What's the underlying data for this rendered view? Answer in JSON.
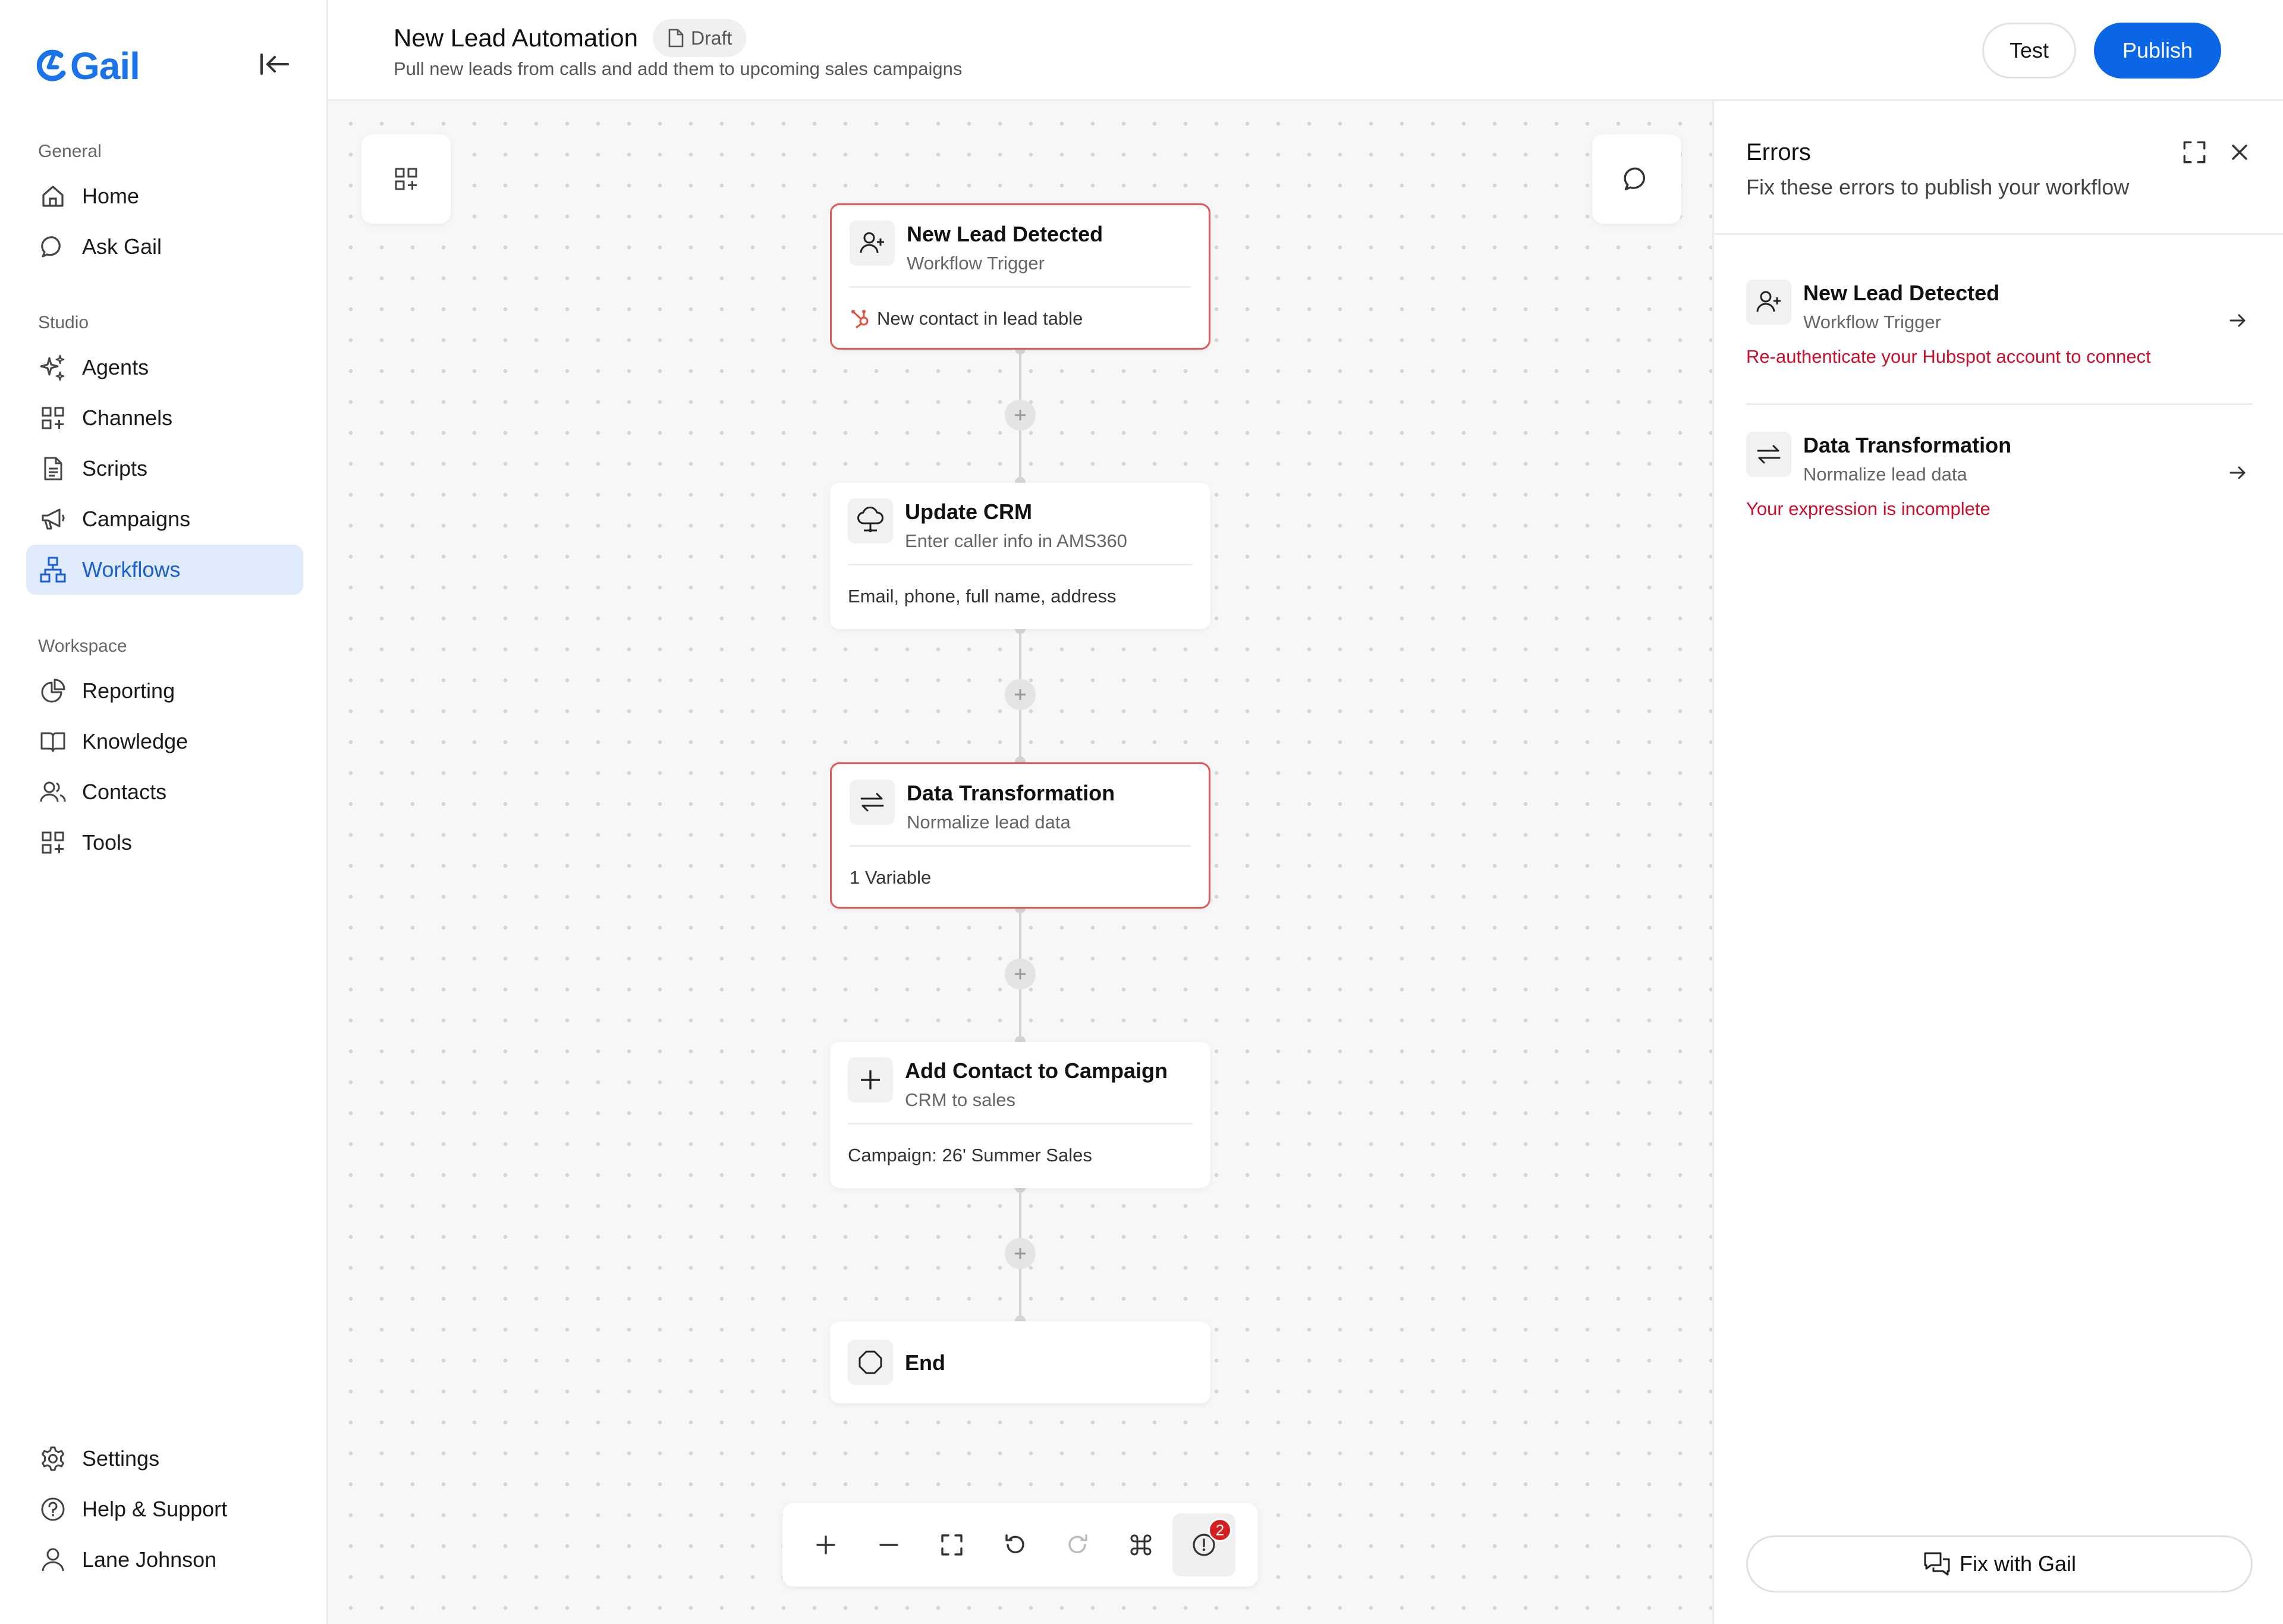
{
  "app": {
    "brand": "Gail",
    "brand_color": "#1a73e8",
    "accent_color": "#0a66e4",
    "error_color": "#c8102e"
  },
  "sidebar": {
    "sections": [
      {
        "label": "General",
        "items": [
          {
            "label": "Home",
            "icon": "home-icon"
          },
          {
            "label": "Ask Gail",
            "icon": "chat-bubble-icon"
          }
        ]
      },
      {
        "label": "Studio",
        "items": [
          {
            "label": "Agents",
            "icon": "sparkle-icon"
          },
          {
            "label": "Channels",
            "icon": "grid-plus-icon"
          },
          {
            "label": "Scripts",
            "icon": "document-icon"
          },
          {
            "label": "Campaigns",
            "icon": "megaphone-icon"
          },
          {
            "label": "Workflows",
            "icon": "workflow-icon",
            "active": true
          }
        ]
      },
      {
        "label": "Workspace",
        "items": [
          {
            "label": "Reporting",
            "icon": "pie-chart-icon"
          },
          {
            "label": "Knowledge",
            "icon": "book-icon"
          },
          {
            "label": "Contacts",
            "icon": "users-icon"
          },
          {
            "label": "Tools",
            "icon": "grid-plus-icon"
          }
        ]
      }
    ],
    "footer": [
      {
        "label": "Settings",
        "icon": "gear-icon"
      },
      {
        "label": "Help & Support",
        "icon": "help-icon"
      },
      {
        "label": "Lane Johnson",
        "icon": "user-icon"
      }
    ]
  },
  "header": {
    "title": "New Lead Automation",
    "status": "Draft",
    "subtitle": "Pull new leads from calls and add them to upcoming sales campaigns",
    "test_label": "Test",
    "publish_label": "Publish"
  },
  "workflow": {
    "nodes": [
      {
        "title": "New Lead Detected",
        "subtitle": "Workflow Trigger",
        "detail": "New contact in lead table",
        "icon": "user-plus-icon",
        "error": true
      },
      {
        "title": "Update CRM",
        "subtitle": "Enter caller info in AMS360",
        "detail": "Email, phone, full name, address",
        "icon": "cloud-icon",
        "error": false
      },
      {
        "title": "Data Transformation",
        "subtitle": "Normalize lead data",
        "detail": "1 Variable",
        "icon": "swap-icon",
        "error": true
      },
      {
        "title": "Add Contact to Campaign",
        "subtitle": "CRM to sales",
        "detail": "Campaign: 26' Summer Sales",
        "icon": "plus-icon",
        "error": false
      }
    ],
    "end_label": "End"
  },
  "toolbar": {
    "error_count": "2"
  },
  "errors_panel": {
    "title": "Errors",
    "subtitle": "Fix these errors to publish your workflow",
    "items": [
      {
        "title": "New Lead Detected",
        "subtitle": "Workflow Trigger",
        "message": "Re-authenticate your Hubspot account to connect"
      },
      {
        "title": "Data Transformation",
        "subtitle": "Normalize lead data",
        "message": "Your expression is incomplete"
      }
    ],
    "fix_label": "Fix with Gail"
  }
}
